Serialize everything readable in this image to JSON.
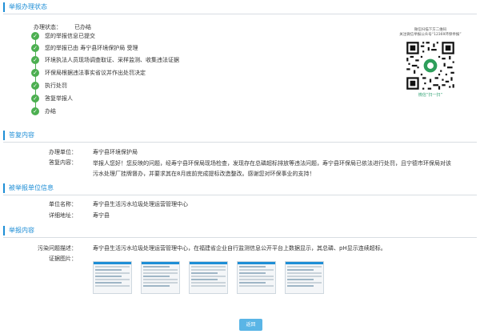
{
  "status_section": {
    "title": "举报办理状态",
    "status_label": "办理状态：",
    "status_value": "已办结",
    "steps": [
      "您的举报信息已提交",
      "您的举报已由 寿宁县环境保护局 受理",
      "环境执法人员现场调查取证、采样监测、收集违法证据",
      "环保局根据违法事实省议并作出处罚决定",
      "执行处罚",
      "答复举报人",
      "办结"
    ],
    "step_icon": "check-icon"
  },
  "qr": {
    "caption_line1": "微信扫描下方二维码",
    "caption_line2": "关注微信举报公众号“12369环保举报”",
    "caption_bottom": "微信“扫一扫”"
  },
  "reply_section": {
    "title": "答复内容",
    "unit_label": "办理单位：",
    "unit_value": "寿宁县环境保护局",
    "content_label": "答复内容：",
    "content_value": "举报人您好！您反映的问题，经寿宁县环保局现场检查，发现存在总磷超标排放等违法问题，寿宁县环保局已依法进行处罚，且宁德市环保局对该污水处理厂挂牌督办，并要求其在8月底前完成提标改造整改。感谢您对环保事业的支持！"
  },
  "reported_section": {
    "title": "被举报单位信息",
    "name_label": "单位名称：",
    "name_value": "寿宁县生活污水垃圾处理运营管理中心",
    "address_label": "详细地址：",
    "address_value": "寿宁县"
  },
  "report_section": {
    "title": "举报内容",
    "desc_label": "污染问题描述：",
    "desc_value": "寿宁县生活污水垃圾处理运营管理中心，在福建省企业自行监测信息公开平台上数据显示，其总磷、pH显示连续超标。",
    "evidence_label": "证据图片："
  },
  "back_button": "返回",
  "colors": {
    "accent": "#1e8ed6",
    "success": "#4caf50",
    "button": "#5ab5e6"
  }
}
